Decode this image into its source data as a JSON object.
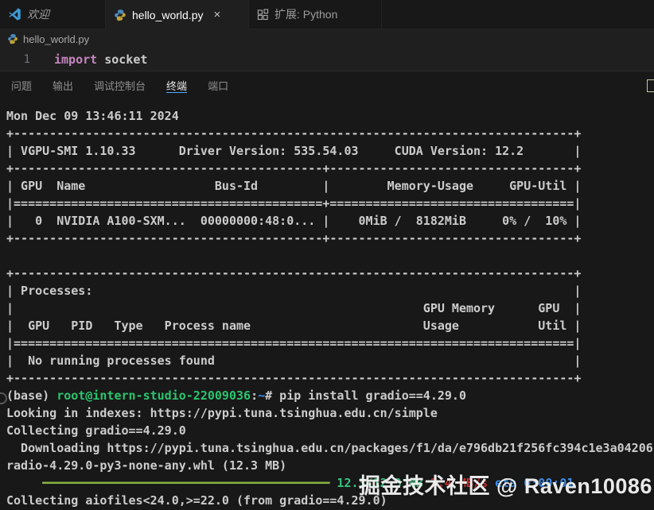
{
  "window": {
    "tabs": [
      {
        "label": "欢迎",
        "icon": "vscode-logo",
        "style": "italic"
      },
      {
        "label": "hello_world.py",
        "icon": "python",
        "close": "×",
        "active": true
      },
      {
        "label": "扩展: Python",
        "icon": "extensions"
      }
    ]
  },
  "breadcrumb": {
    "file": "hello_world.py"
  },
  "editor": {
    "line_number": "1",
    "keyword": "import",
    "code_rest": " socket"
  },
  "panel": {
    "tabs": [
      {
        "label": "问题"
      },
      {
        "label": "输出"
      },
      {
        "label": "调试控制台"
      },
      {
        "label": "终端",
        "active": true
      },
      {
        "label": "端口"
      }
    ]
  },
  "terminal": {
    "lines": [
      "Mon Dec 09 13:46:11 2024",
      "+------------------------------------------------------------------------------+",
      "| VGPU-SMI 1.10.33      Driver Version: 535.54.03     CUDA Version: 12.2       |",
      "+-------------------------------------------+----------------------------------+",
      "| GPU  Name                  Bus-Id         |        Memory-Usage     GPU-Util |",
      "|===========================================+==================================|",
      "|   0  NVIDIA A100-SXM...  00000000:48:0... |    0MiB /  8182MiB     0% /  10% |",
      "+-------------------------------------------+----------------------------------+",
      "",
      "+------------------------------------------------------------------------------+",
      "| Processes:                                                                   |",
      "|                                                         GPU Memory      GPU  |",
      "|  GPU   PID   Type   Process name                        Usage           Util |",
      "|==============================================================================|",
      "|  No running processes found                                                  |",
      "+------------------------------------------------------------------------------+",
      [
        {
          "t": "(base) "
        },
        {
          "t": "root@intern-studio-22009036",
          "c": "user"
        },
        {
          "t": ":"
        },
        {
          "t": "~",
          "c": "path"
        },
        {
          "t": "# pip install gradio==4.29.0"
        }
      ],
      "Looking in indexes: https://pypi.tuna.tsinghua.edu.cn/simple",
      "Collecting gradio==4.29.0",
      "  Downloading https://pypi.tuna.tsinghua.edu.cn/packages/f1/da/e796db21f256fc394c1e3a04206",
      "radio-4.29.0-py3-none-any.whl (12.3 MB)",
      [
        {
          "t": "     "
        },
        {
          "t": "━━━━━━━━━━━━━━━━━━━━━━━━━━━━━━━━━━━━━━━━",
          "c": "bar"
        },
        {
          "t": " "
        },
        {
          "t": "12.3/12.3 MB",
          "c": "num"
        },
        {
          "t": " "
        },
        {
          "t": "3.4 MB/s",
          "c": "speed"
        },
        {
          "t": " "
        },
        {
          "t": "eta 0:00:01",
          "c": "eta"
        }
      ],
      "Collecting aiofiles<24.0,>=22.0 (from gradio==4.29.0)"
    ]
  },
  "watermark": {
    "text": "掘金技术社区 @ Raven10086"
  },
  "colors": {
    "accent": "#4daafc",
    "keyword": "#c586c0",
    "user": "#2bc46f",
    "path": "#3b8eea",
    "bar": "#86b340",
    "num": "#39c382",
    "speed": "#cd3131",
    "eta": "#3b8eea"
  }
}
